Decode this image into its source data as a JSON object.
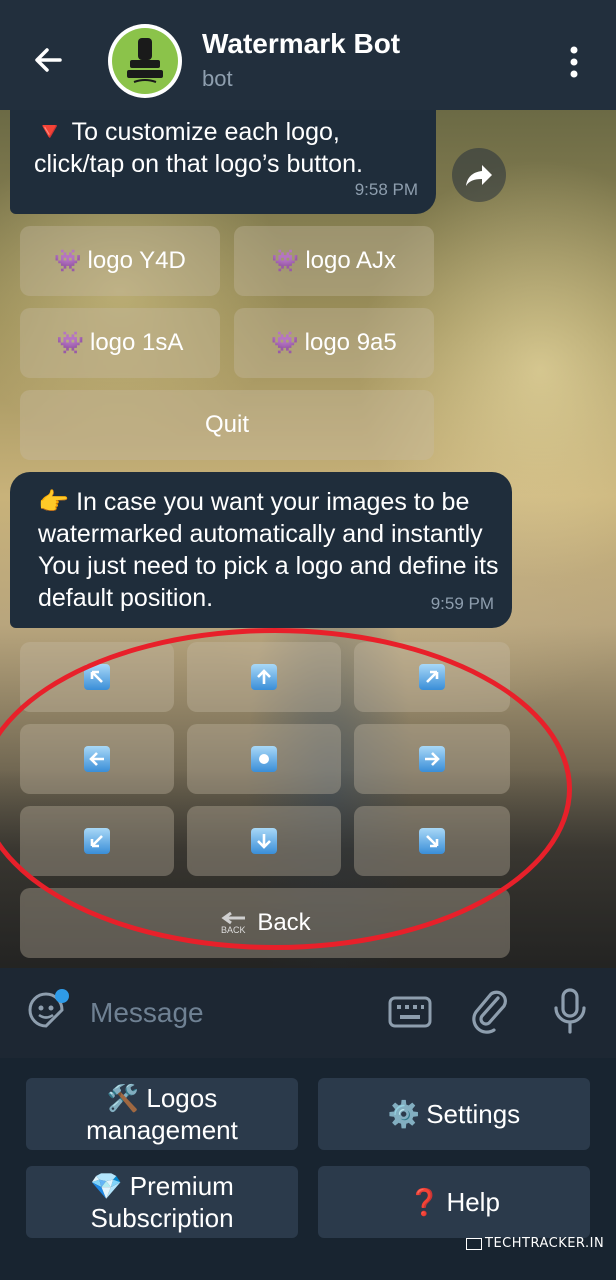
{
  "header": {
    "back_icon": "arrow-left-icon",
    "title": "Watermark Bot",
    "subtitle": "bot",
    "menu_icon": "vertical-dots-icon"
  },
  "messages": [
    {
      "emoji": "🔻",
      "text": "To customize each logo, click/tap on that logo’s button.",
      "time": "9:58 PM"
    },
    {
      "emoji": "👉",
      "text": "In case you want your images to be watermarked automatically and instantly You just need to pick a logo and define its default position.",
      "time": "9:59 PM"
    }
  ],
  "logo_buttons": [
    {
      "emoji": "👾",
      "label": "logo Y4D"
    },
    {
      "emoji": "👾",
      "label": "logo AJx"
    },
    {
      "emoji": "👾",
      "label": "logo 1sA"
    },
    {
      "emoji": "👾",
      "label": "logo 9a5"
    }
  ],
  "quit_label": "Quit",
  "position_buttons": [
    {
      "name": "top-left",
      "icon": "arrow-up-left-icon"
    },
    {
      "name": "top",
      "icon": "arrow-up-icon"
    },
    {
      "name": "top-right",
      "icon": "arrow-up-right-icon"
    },
    {
      "name": "left",
      "icon": "arrow-left-icon"
    },
    {
      "name": "center",
      "icon": "center-dot-icon"
    },
    {
      "name": "right",
      "icon": "arrow-right-icon"
    },
    {
      "name": "bottom-left",
      "icon": "arrow-down-left-icon"
    },
    {
      "name": "bottom",
      "icon": "arrow-down-icon"
    },
    {
      "name": "bottom-right",
      "icon": "arrow-down-right-icon"
    }
  ],
  "back_button": {
    "icon_text": "BACK",
    "label": "Back"
  },
  "composer": {
    "placeholder": "Message",
    "icons": [
      "sticker-icon",
      "keyboard-icon",
      "paperclip-icon",
      "microphone-icon"
    ]
  },
  "reply_keyboard": {
    "logos": {
      "emoji": "🛠️",
      "line1": "Logos",
      "line2": "management"
    },
    "settings": {
      "emoji": "⚙️",
      "label": "Settings"
    },
    "premium": {
      "emoji": "💎",
      "line1": "Premium",
      "line2": "Subscription"
    },
    "help": {
      "emoji": "❓",
      "label": "Help"
    }
  },
  "credit": "TECHTRACKER.IN",
  "colors": {
    "accent": "#2f9be8",
    "annotation": "#e8202a",
    "bubble": "#1f2d3b"
  }
}
